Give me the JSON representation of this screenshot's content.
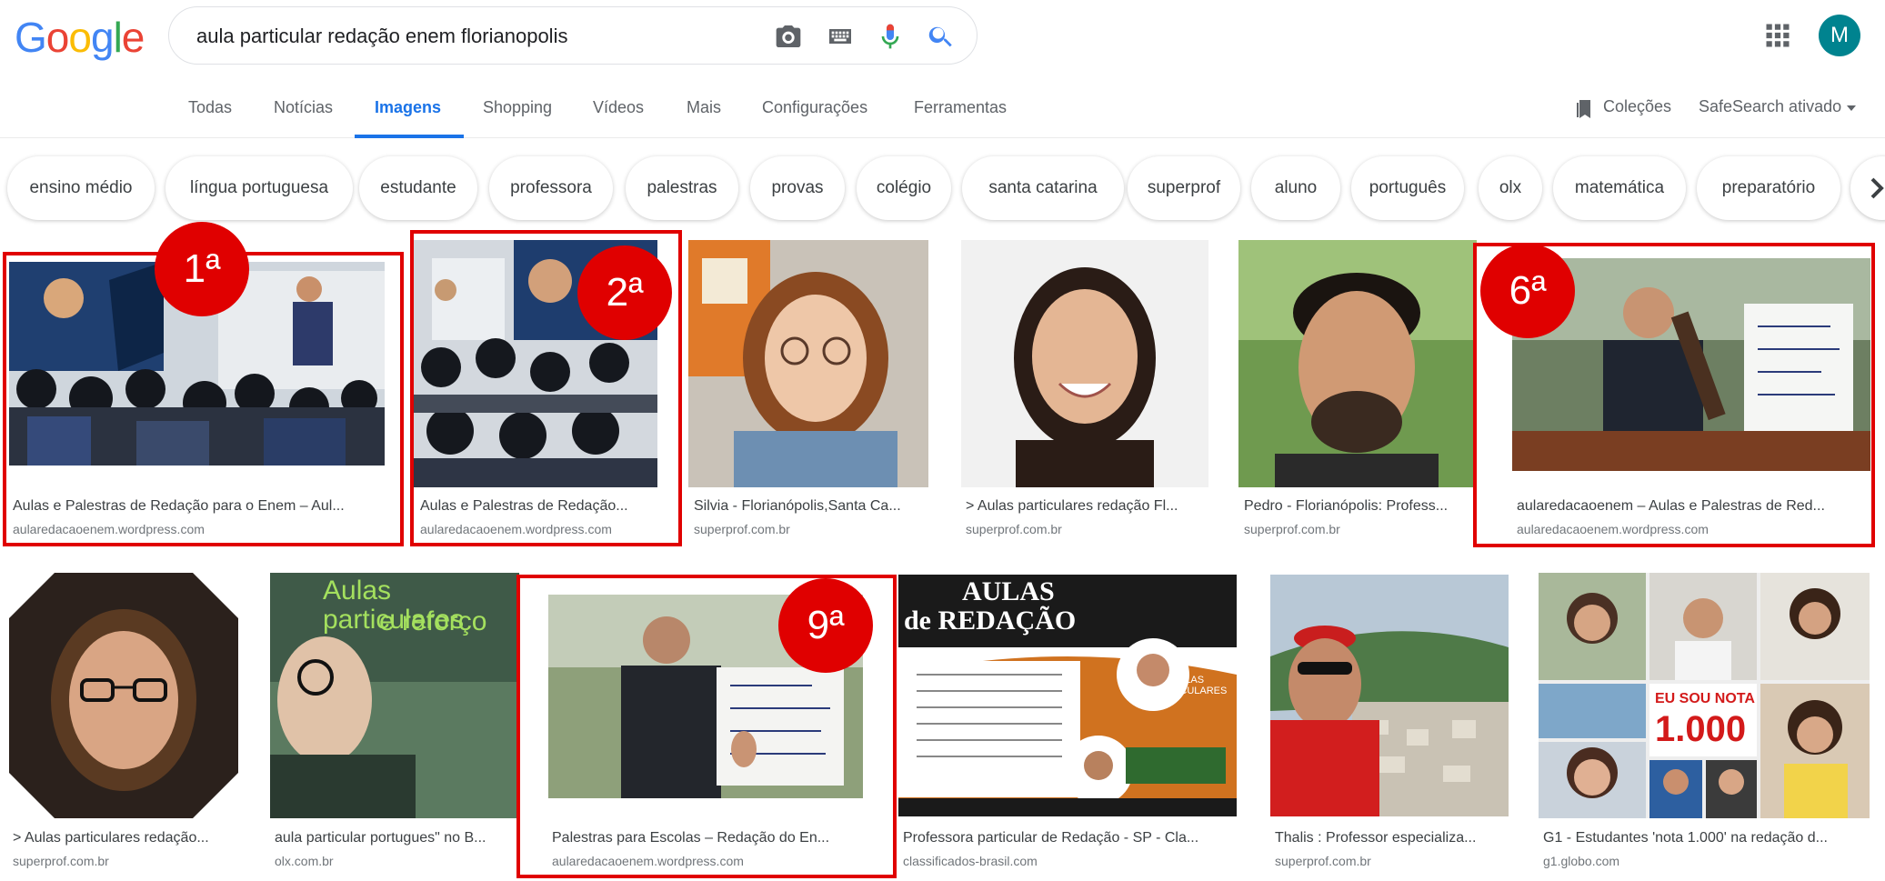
{
  "header": {
    "logo_letters": [
      "G",
      "o",
      "o",
      "g",
      "l",
      "e"
    ],
    "logo_colors": [
      "#4285f4",
      "#ea4335",
      "#fbbc05",
      "#4285f4",
      "#34a853",
      "#ea4335"
    ],
    "query": "aula particular redação enem florianopolis",
    "avatar_letter": "M"
  },
  "tabs": [
    "Todas",
    "Notícias",
    "Imagens",
    "Shopping",
    "Vídeos",
    "Mais",
    "Configurações",
    "Ferramentas"
  ],
  "active_tab": "Imagens",
  "right_tools": {
    "collections": "Coleções",
    "safesearch": "SafeSearch ativado"
  },
  "chips": [
    "ensino médio",
    "língua portuguesa",
    "estudante",
    "professora",
    "palestras",
    "provas",
    "colégio",
    "santa catarina",
    "superprof",
    "aluno",
    "português",
    "olx",
    "matemática",
    "preparatório"
  ],
  "results_row1": [
    {
      "caption": "Aulas e Palestras de Redação para o Enem – Aul...",
      "source": "aularedacaoenem.wordpress.com",
      "badge": "1ª"
    },
    {
      "caption": "Aulas e Palestras de Redação...",
      "source": "aularedacaoenem.wordpress.com",
      "badge": "2ª"
    },
    {
      "caption": "Silvia - Florianópolis,Santa Ca...",
      "source": "superprof.com.br"
    },
    {
      "caption": "> Aulas particulares redação Fl...",
      "source": "superprof.com.br"
    },
    {
      "caption": "Pedro - Florianópolis: Profess...",
      "source": "superprof.com.br"
    },
    {
      "caption": "aularedacaoenem – Aulas e Palestras de Red...",
      "source": "aularedacaoenem.wordpress.com",
      "badge": "6ª"
    }
  ],
  "results_row2": [
    {
      "caption": "> Aulas particulares redação...",
      "source": "superprof.com.br"
    },
    {
      "caption": "aula particular portugues\" no B...",
      "source": "olx.com.br"
    },
    {
      "caption": "Palestras para Escolas – Redação do En...",
      "source": "aularedacaoenem.wordpress.com",
      "badge": "9ª"
    },
    {
      "caption": "Professora particular de Redação - SP - Cla...",
      "source": "classificados-brasil.com"
    },
    {
      "caption": "Thalis : Professor especializa...",
      "source": "superprof.com.br"
    },
    {
      "caption": "G1 - Estudantes 'nota 1.000' na redação d...",
      "source": "g1.globo.com"
    }
  ],
  "image_text": {
    "aulas_reforco_1": "Aulas particulares",
    "aulas_reforco_2": "e reforço",
    "aulas_redacao_1": "AULAS",
    "aulas_redacao_2": "de REDAÇÃO",
    "aulas_particulares_label": "AULAS PARTICULARES",
    "nota_1": "EU SOU NOTA",
    "nota_2": "1.000"
  },
  "colors": {
    "accent_blue": "#1a73e8",
    "annotation_red": "#e00000"
  }
}
